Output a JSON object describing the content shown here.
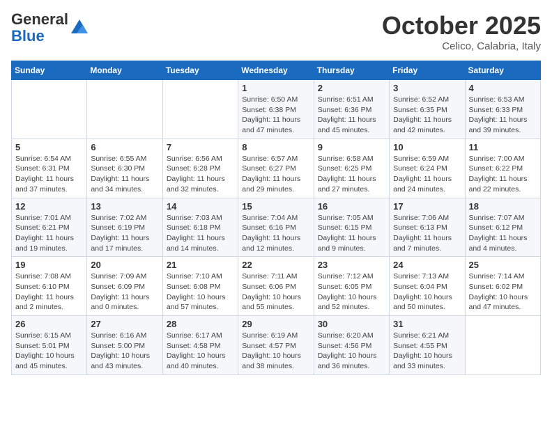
{
  "header": {
    "logo_general": "General",
    "logo_blue": "Blue",
    "month_title": "October 2025",
    "subtitle": "Celico, Calabria, Italy"
  },
  "weekdays": [
    "Sunday",
    "Monday",
    "Tuesday",
    "Wednesday",
    "Thursday",
    "Friday",
    "Saturday"
  ],
  "weeks": [
    [
      {
        "day": "",
        "info": ""
      },
      {
        "day": "",
        "info": ""
      },
      {
        "day": "",
        "info": ""
      },
      {
        "day": "1",
        "info": "Sunrise: 6:50 AM\nSunset: 6:38 PM\nDaylight: 11 hours and 47 minutes."
      },
      {
        "day": "2",
        "info": "Sunrise: 6:51 AM\nSunset: 6:36 PM\nDaylight: 11 hours and 45 minutes."
      },
      {
        "day": "3",
        "info": "Sunrise: 6:52 AM\nSunset: 6:35 PM\nDaylight: 11 hours and 42 minutes."
      },
      {
        "day": "4",
        "info": "Sunrise: 6:53 AM\nSunset: 6:33 PM\nDaylight: 11 hours and 39 minutes."
      }
    ],
    [
      {
        "day": "5",
        "info": "Sunrise: 6:54 AM\nSunset: 6:31 PM\nDaylight: 11 hours and 37 minutes."
      },
      {
        "day": "6",
        "info": "Sunrise: 6:55 AM\nSunset: 6:30 PM\nDaylight: 11 hours and 34 minutes."
      },
      {
        "day": "7",
        "info": "Sunrise: 6:56 AM\nSunset: 6:28 PM\nDaylight: 11 hours and 32 minutes."
      },
      {
        "day": "8",
        "info": "Sunrise: 6:57 AM\nSunset: 6:27 PM\nDaylight: 11 hours and 29 minutes."
      },
      {
        "day": "9",
        "info": "Sunrise: 6:58 AM\nSunset: 6:25 PM\nDaylight: 11 hours and 27 minutes."
      },
      {
        "day": "10",
        "info": "Sunrise: 6:59 AM\nSunset: 6:24 PM\nDaylight: 11 hours and 24 minutes."
      },
      {
        "day": "11",
        "info": "Sunrise: 7:00 AM\nSunset: 6:22 PM\nDaylight: 11 hours and 22 minutes."
      }
    ],
    [
      {
        "day": "12",
        "info": "Sunrise: 7:01 AM\nSunset: 6:21 PM\nDaylight: 11 hours and 19 minutes."
      },
      {
        "day": "13",
        "info": "Sunrise: 7:02 AM\nSunset: 6:19 PM\nDaylight: 11 hours and 17 minutes."
      },
      {
        "day": "14",
        "info": "Sunrise: 7:03 AM\nSunset: 6:18 PM\nDaylight: 11 hours and 14 minutes."
      },
      {
        "day": "15",
        "info": "Sunrise: 7:04 AM\nSunset: 6:16 PM\nDaylight: 11 hours and 12 minutes."
      },
      {
        "day": "16",
        "info": "Sunrise: 7:05 AM\nSunset: 6:15 PM\nDaylight: 11 hours and 9 minutes."
      },
      {
        "day": "17",
        "info": "Sunrise: 7:06 AM\nSunset: 6:13 PM\nDaylight: 11 hours and 7 minutes."
      },
      {
        "day": "18",
        "info": "Sunrise: 7:07 AM\nSunset: 6:12 PM\nDaylight: 11 hours and 4 minutes."
      }
    ],
    [
      {
        "day": "19",
        "info": "Sunrise: 7:08 AM\nSunset: 6:10 PM\nDaylight: 11 hours and 2 minutes."
      },
      {
        "day": "20",
        "info": "Sunrise: 7:09 AM\nSunset: 6:09 PM\nDaylight: 11 hours and 0 minutes."
      },
      {
        "day": "21",
        "info": "Sunrise: 7:10 AM\nSunset: 6:08 PM\nDaylight: 10 hours and 57 minutes."
      },
      {
        "day": "22",
        "info": "Sunrise: 7:11 AM\nSunset: 6:06 PM\nDaylight: 10 hours and 55 minutes."
      },
      {
        "day": "23",
        "info": "Sunrise: 7:12 AM\nSunset: 6:05 PM\nDaylight: 10 hours and 52 minutes."
      },
      {
        "day": "24",
        "info": "Sunrise: 7:13 AM\nSunset: 6:04 PM\nDaylight: 10 hours and 50 minutes."
      },
      {
        "day": "25",
        "info": "Sunrise: 7:14 AM\nSunset: 6:02 PM\nDaylight: 10 hours and 47 minutes."
      }
    ],
    [
      {
        "day": "26",
        "info": "Sunrise: 6:15 AM\nSunset: 5:01 PM\nDaylight: 10 hours and 45 minutes."
      },
      {
        "day": "27",
        "info": "Sunrise: 6:16 AM\nSunset: 5:00 PM\nDaylight: 10 hours and 43 minutes."
      },
      {
        "day": "28",
        "info": "Sunrise: 6:17 AM\nSunset: 4:58 PM\nDaylight: 10 hours and 40 minutes."
      },
      {
        "day": "29",
        "info": "Sunrise: 6:19 AM\nSunset: 4:57 PM\nDaylight: 10 hours and 38 minutes."
      },
      {
        "day": "30",
        "info": "Sunrise: 6:20 AM\nSunset: 4:56 PM\nDaylight: 10 hours and 36 minutes."
      },
      {
        "day": "31",
        "info": "Sunrise: 6:21 AM\nSunset: 4:55 PM\nDaylight: 10 hours and 33 minutes."
      },
      {
        "day": "",
        "info": ""
      }
    ]
  ]
}
